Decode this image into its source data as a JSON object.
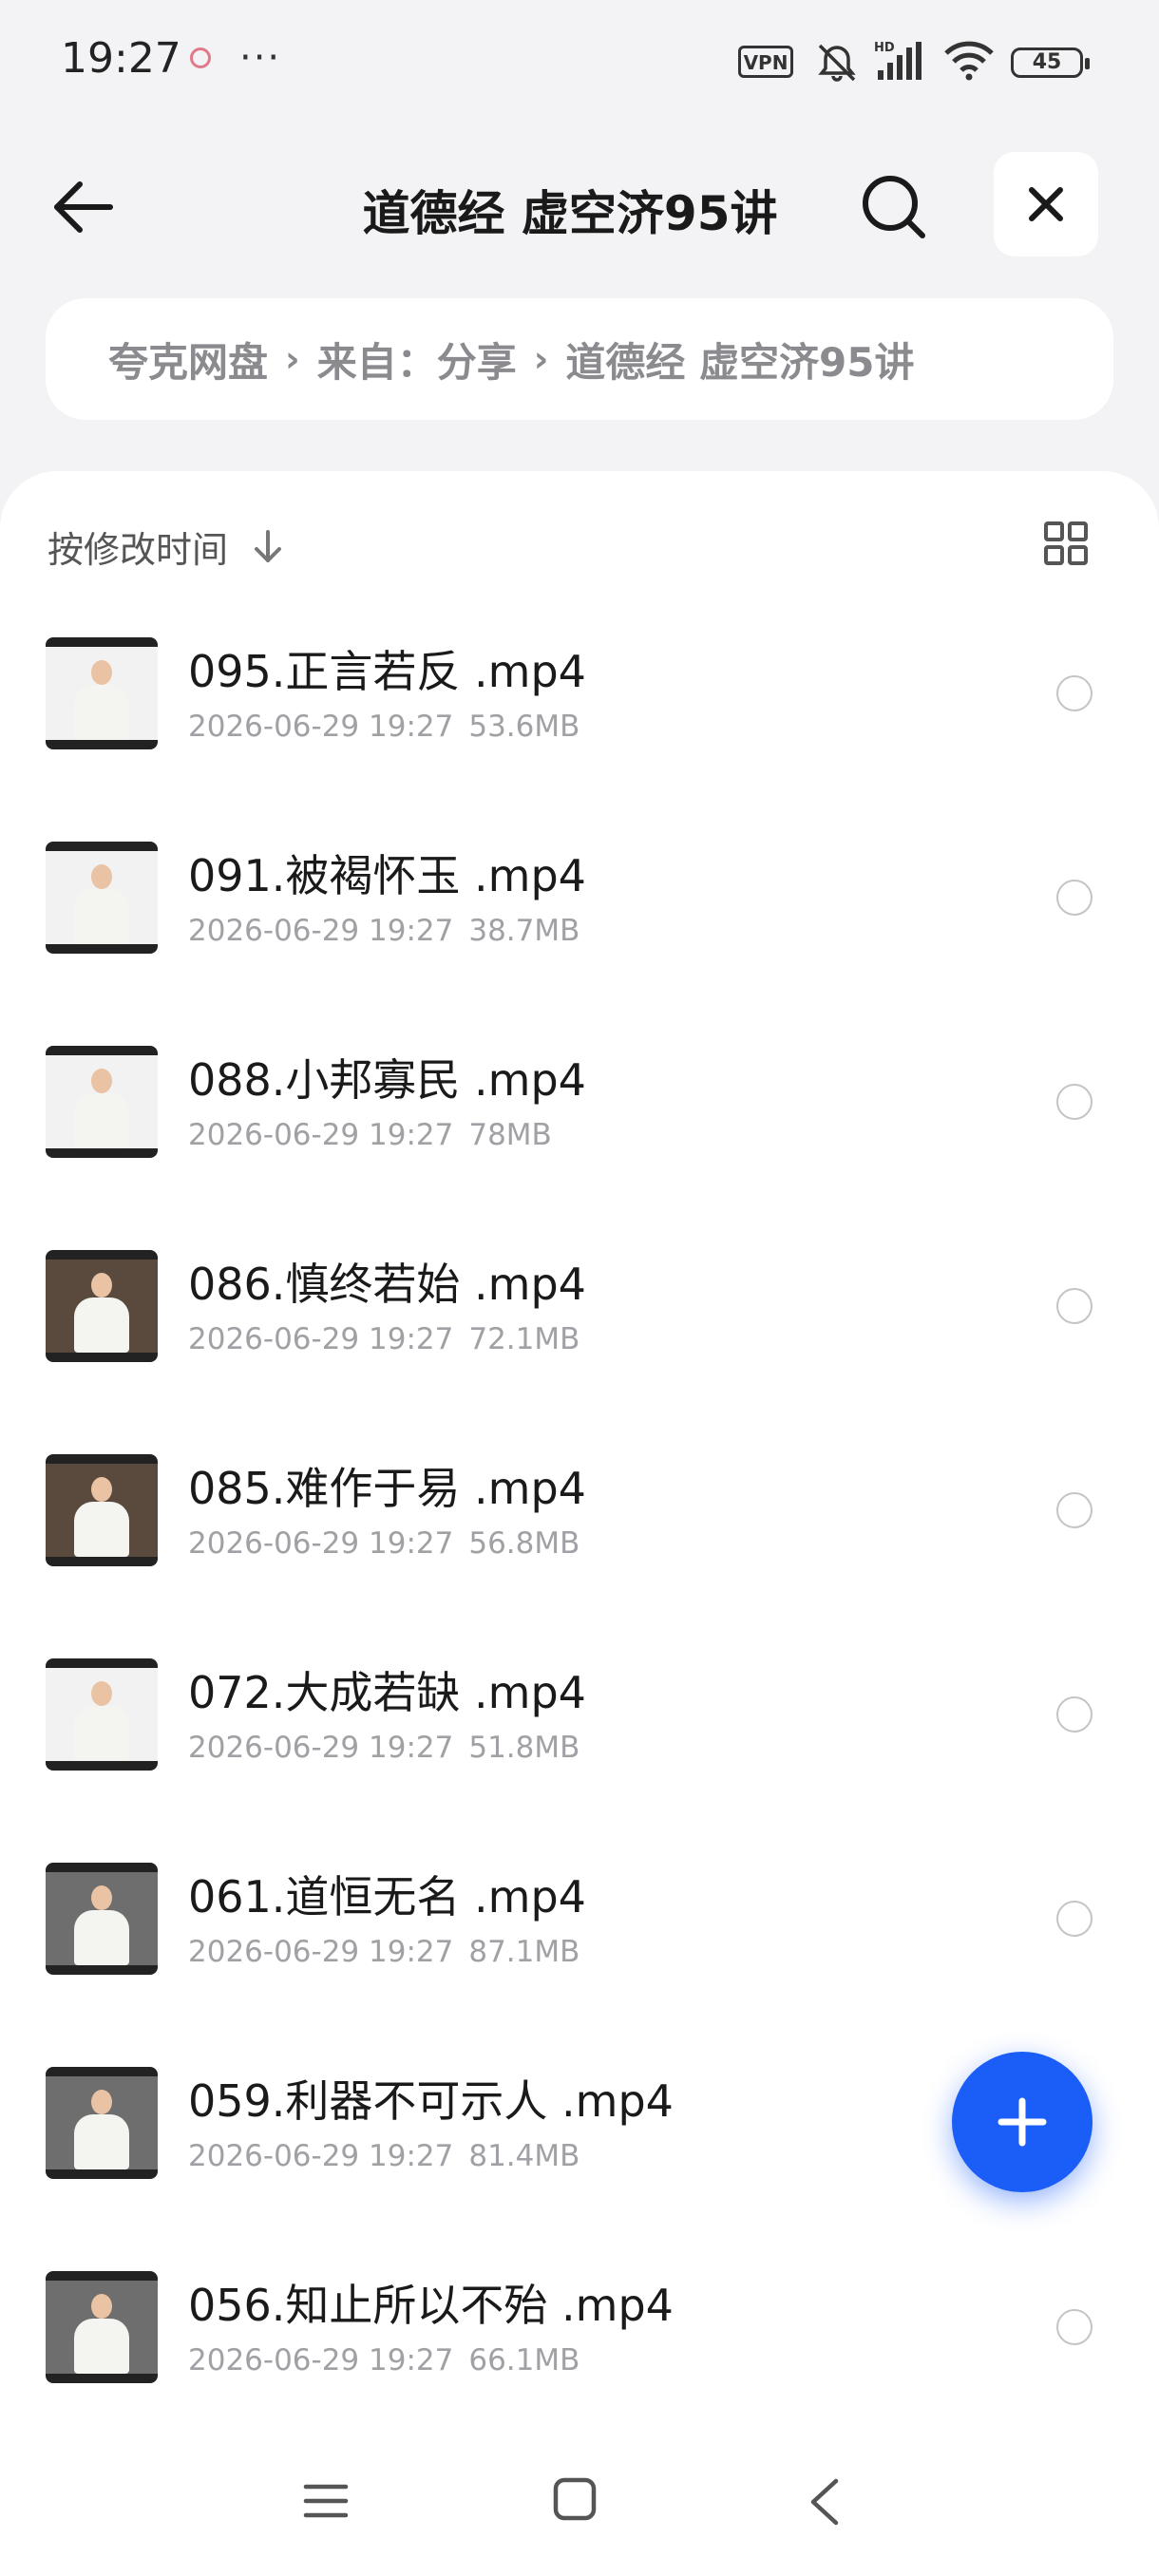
{
  "status_bar": {
    "time": "19:27",
    "more": "···",
    "vpn": "VPN",
    "battery": "45",
    "icons": [
      "alarm-icon",
      "mute-icon",
      "hd-signal-icon",
      "wifi-icon",
      "battery-icon"
    ]
  },
  "header": {
    "title": "道德经 虚空济95讲",
    "icons": [
      "back-arrow-icon",
      "search-icon",
      "close-icon"
    ]
  },
  "breadcrumb": {
    "items": [
      "夸克网盘",
      "来自：分享",
      "道德经 虚空济95讲"
    ],
    "separator": "›"
  },
  "toolbar": {
    "sort_label": "按修改时间",
    "sort_icon": "sort-down-arrow-icon",
    "view_icon": "grid-view-icon"
  },
  "files": [
    {
      "name": "095.正言若反 .mp4",
      "date": "2026-06-29 19:27",
      "size": "53.6MB",
      "bg": "#f2f2f2"
    },
    {
      "name": "091.被褐怀玉 .mp4",
      "date": "2026-06-29 19:27",
      "size": "38.7MB",
      "bg": "#f2f2f2"
    },
    {
      "name": "088.小邦寡民 .mp4",
      "date": "2026-06-29 19:27",
      "size": "78MB",
      "bg": "#f2f2f2"
    },
    {
      "name": "086.慎终若始 .mp4",
      "date": "2026-06-29 19:27",
      "size": "72.1MB",
      "bg": "#5a4a3e"
    },
    {
      "name": "085.难作于易 .mp4",
      "date": "2026-06-29 19:27",
      "size": "56.8MB",
      "bg": "#5a4a3e"
    },
    {
      "name": "072.大成若缺 .mp4",
      "date": "2026-06-29 19:27",
      "size": "51.8MB",
      "bg": "#f2f2f2"
    },
    {
      "name": "061.道恒无名 .mp4",
      "date": "2026-06-29 19:27",
      "size": "87.1MB",
      "bg": "#6e6e6e"
    },
    {
      "name": "059.利器不可示人 .mp4",
      "date": "2026-06-29 19:27",
      "size": "81.4MB",
      "bg": "#6e6e6e"
    },
    {
      "name": "056.知止所以不殆 .mp4",
      "date": "2026-06-29 19:27",
      "size": "66.1MB",
      "bg": "#6e6e6e"
    }
  ],
  "fab": {
    "icon": "plus-icon"
  },
  "nav_bar": {
    "icons": [
      "menu-icon",
      "home-icon",
      "back-icon"
    ]
  }
}
